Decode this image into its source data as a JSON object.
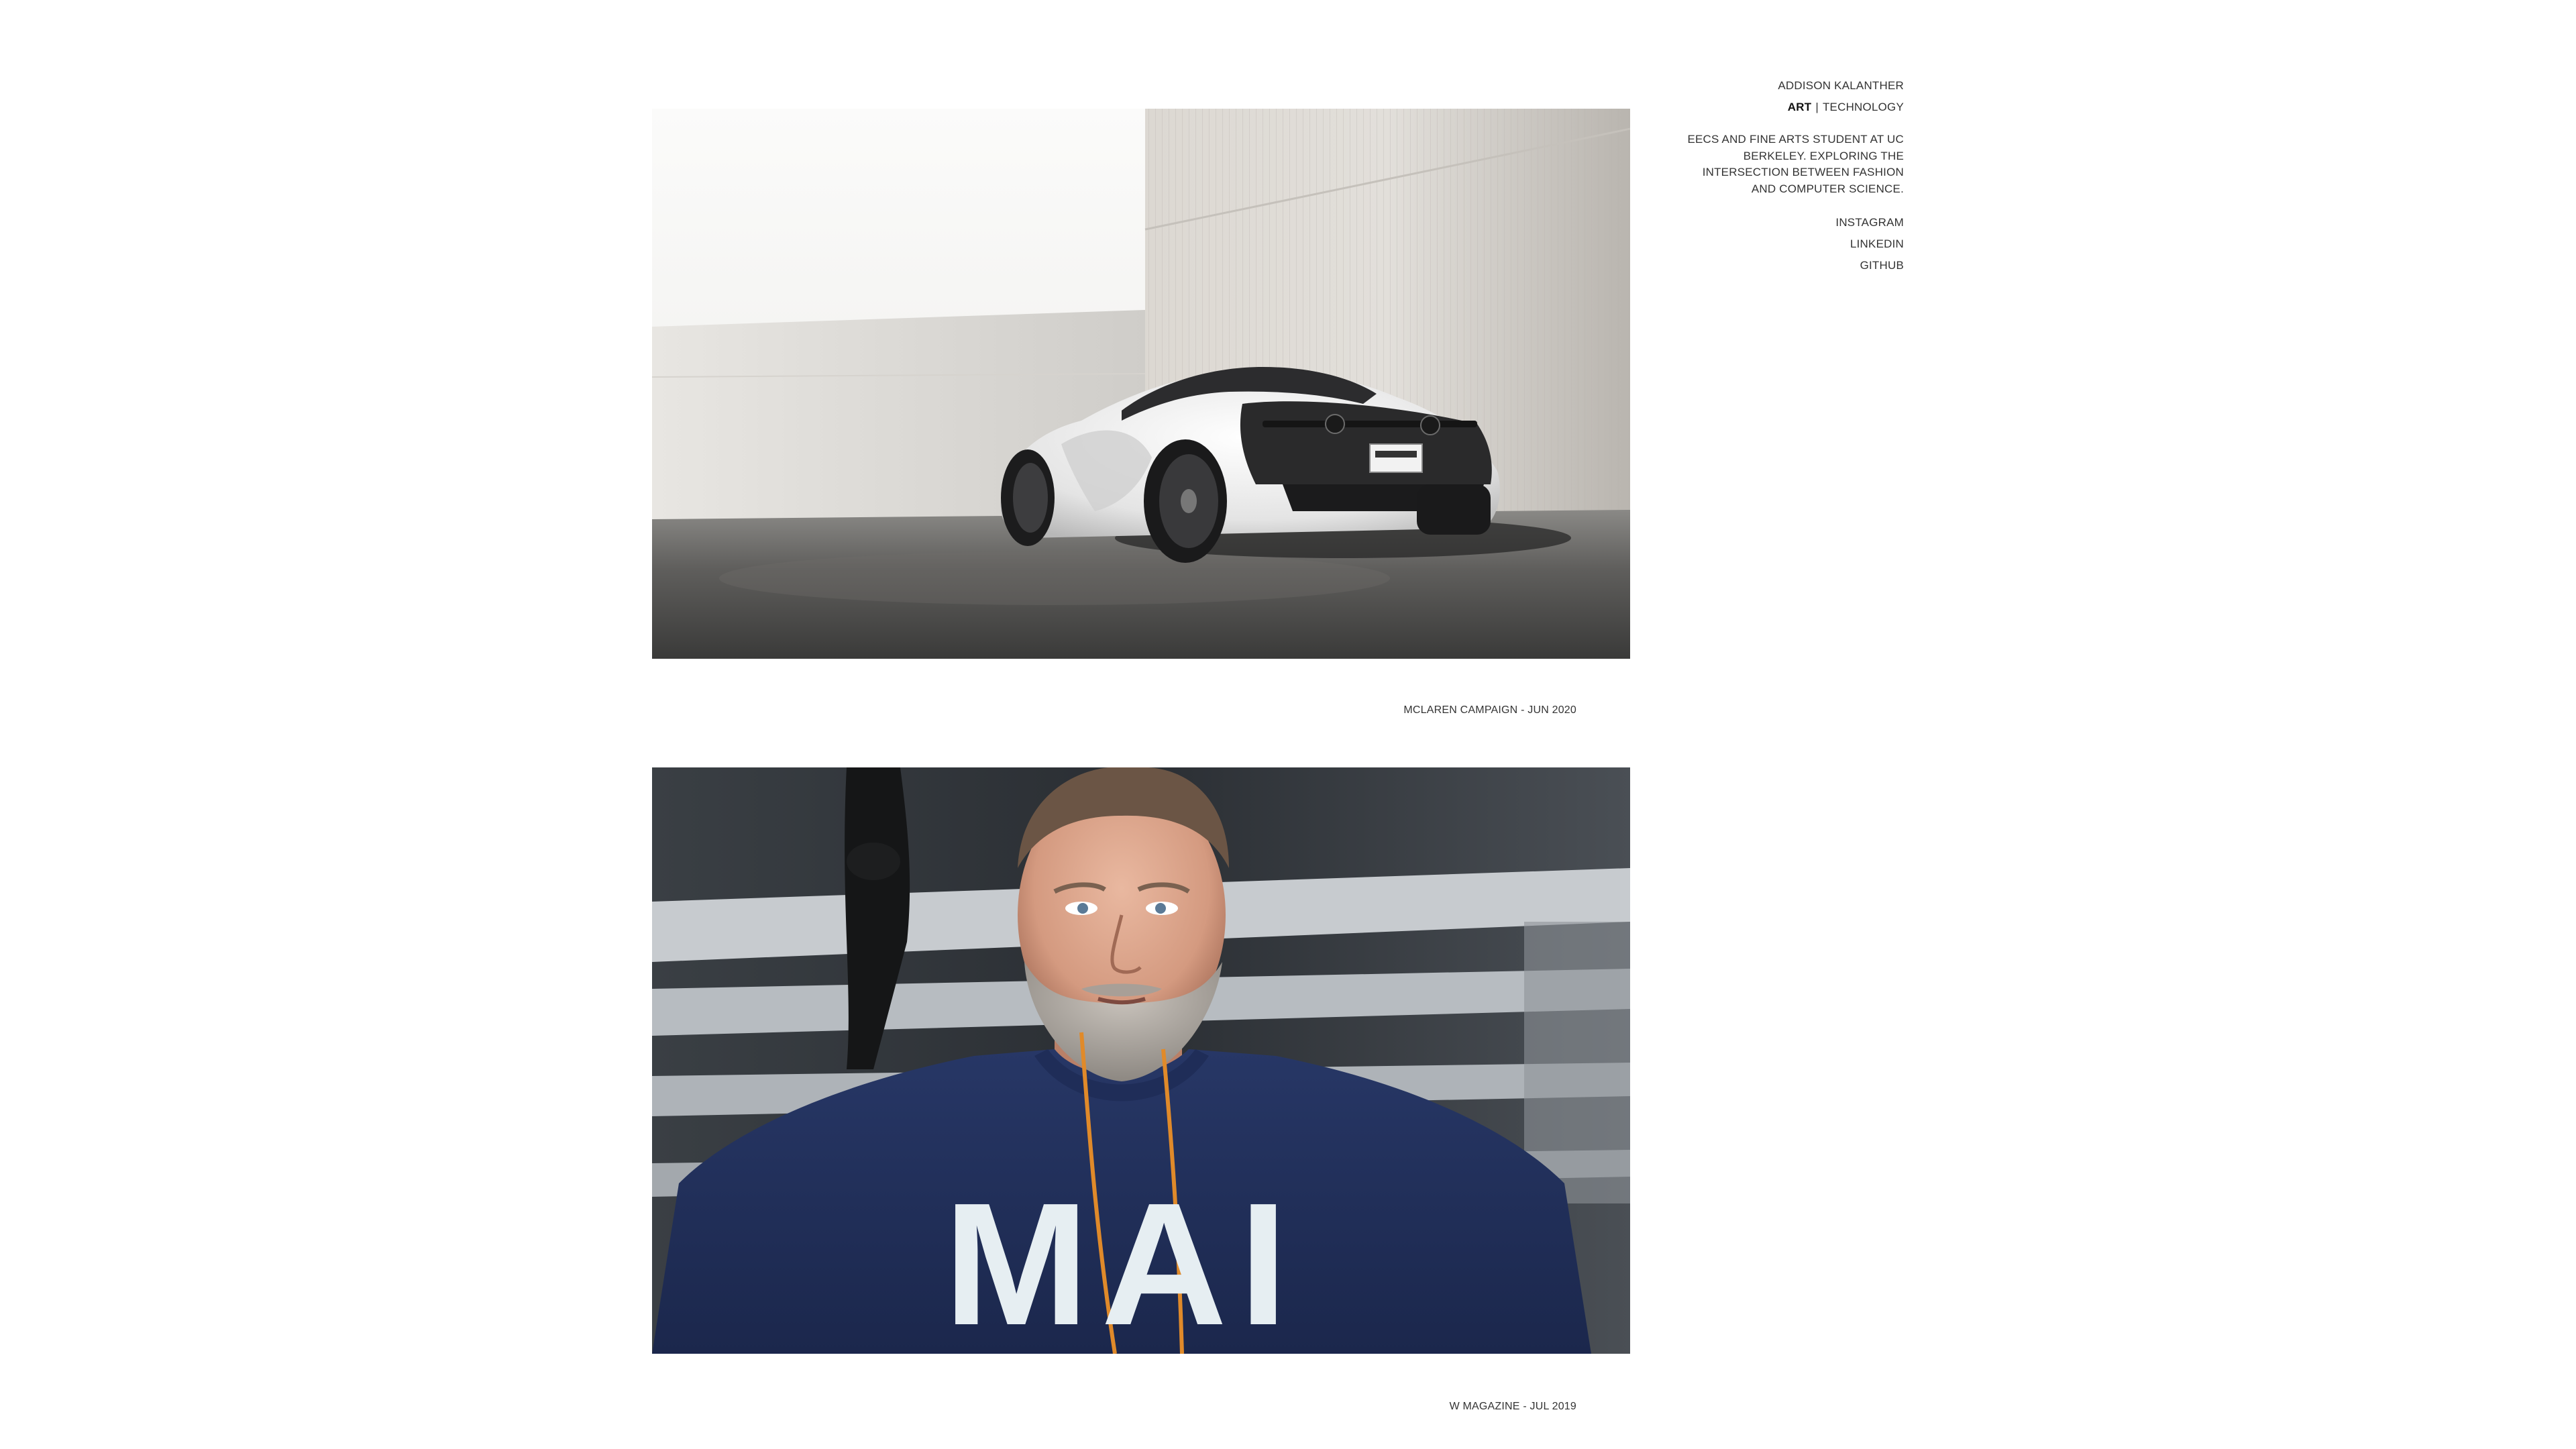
{
  "profile": {
    "name": "ADDISON KALANTHER",
    "nav": {
      "active": "ART",
      "separator": "|",
      "other": "TECHNOLOGY"
    },
    "bio": "EECS AND FINE ARTS STUDENT AT UC BERKELEY. EXPLORING THE INTERSECTION BETWEEN FASHION AND COMPUTER SCIENCE.",
    "links": [
      "INSTAGRAM",
      "LINKEDIN",
      "GITHUB"
    ]
  },
  "gallery": [
    {
      "caption": "MCLAREN CAMPAIGN - JUN 2020"
    },
    {
      "caption": "W MAGAZINE - JUL 2019",
      "sweater_text": "MAI"
    }
  ]
}
